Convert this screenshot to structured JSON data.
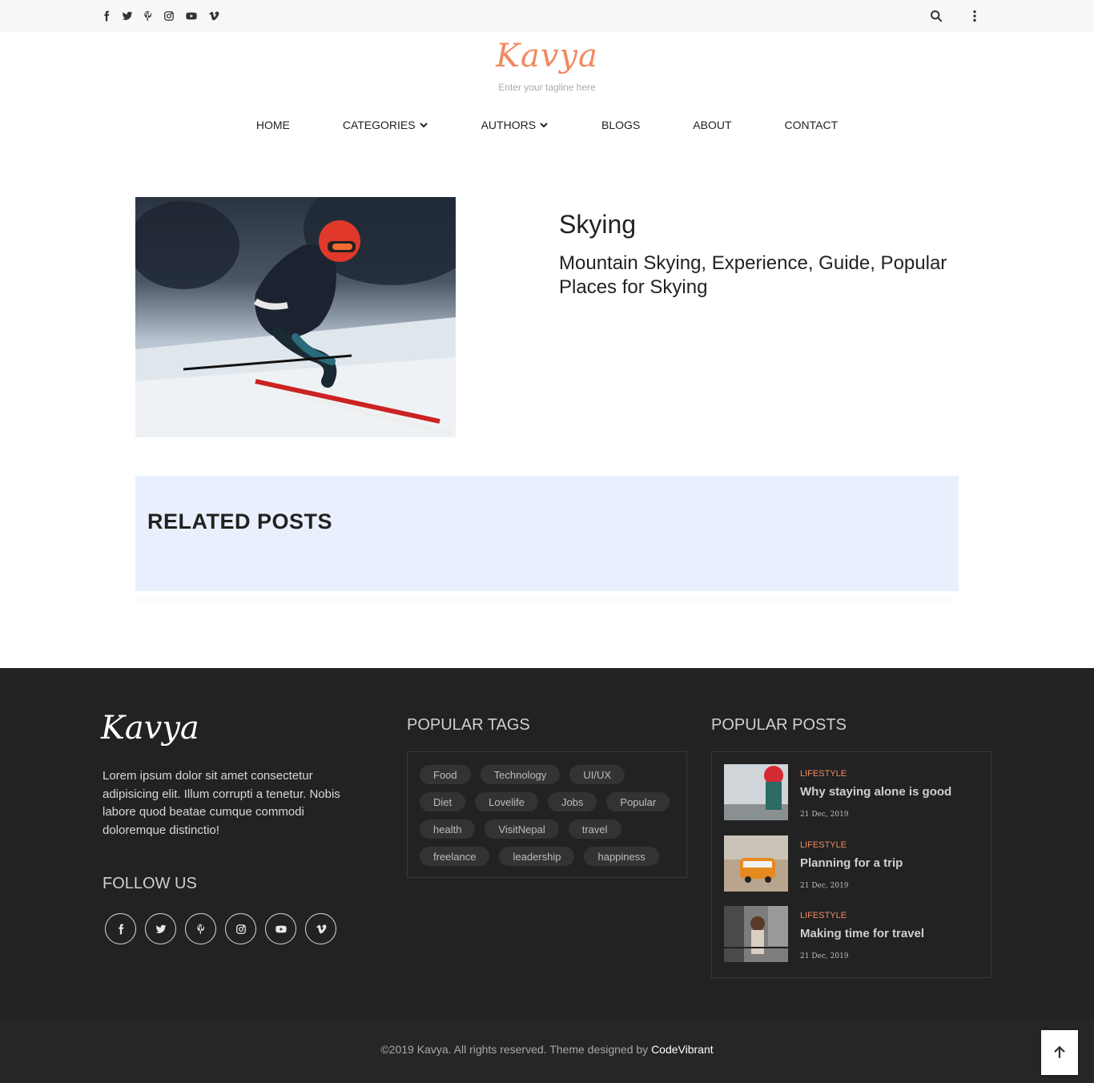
{
  "topbar": {
    "social_icons": [
      "facebook-icon",
      "twitter-icon",
      "pinterest-icon",
      "instagram-icon",
      "youtube-icon",
      "vimeo-icon"
    ],
    "right_icons": [
      "search-icon",
      "more-vertical-icon"
    ]
  },
  "brand": {
    "logo": "Kavya",
    "tagline": "Enter your tagline here",
    "accent_color": "#f08a60"
  },
  "nav": {
    "items": [
      {
        "label": "HOME",
        "dropdown": false
      },
      {
        "label": "CATEGORIES",
        "dropdown": true
      },
      {
        "label": "AUTHORS",
        "dropdown": true
      },
      {
        "label": "BLOGS",
        "dropdown": false
      },
      {
        "label": "ABOUT",
        "dropdown": false
      },
      {
        "label": "CONTACT",
        "dropdown": false
      }
    ]
  },
  "post": {
    "title": "Skying",
    "subtitle": "Mountain Skying, Experience, Guide, Popular Places for Skying"
  },
  "related": {
    "heading": "RELATED POSTS"
  },
  "footer": {
    "logo": "Kavya",
    "about": "Lorem ipsum dolor sit amet consectetur adipisicing elit. Illum corrupti a tenetur. Nobis labore quod beatae cumque commodi doloremque distinctio!",
    "follow_heading": "FOLLOW US",
    "social_icons": [
      "facebook-icon",
      "twitter-icon",
      "pinterest-icon",
      "instagram-icon",
      "youtube-icon",
      "vimeo-icon"
    ],
    "tags_heading": "POPULAR TAGS",
    "tags": [
      "Food",
      "Technology",
      "UI/UX",
      "Diet",
      "Lovelife",
      "Jobs",
      "Popular",
      "health",
      "VisitNepal",
      "travel",
      "freelance",
      "leadership",
      "happiness"
    ],
    "posts_heading": "POPULAR POSTS",
    "posts": [
      {
        "category": "LIFESTYLE",
        "title": "Why staying alone is good",
        "date": "21 Dec, 2019"
      },
      {
        "category": "LIFESTYLE",
        "title": "Planning for a trip",
        "date": "21 Dec, 2019"
      },
      {
        "category": "LIFESTYLE",
        "title": "Making time for travel",
        "date": "21 Dec, 2019"
      }
    ],
    "copyright": "©2019 Kavya. All rights reserved. Theme designed by ",
    "designer": "CodeVibrant"
  }
}
